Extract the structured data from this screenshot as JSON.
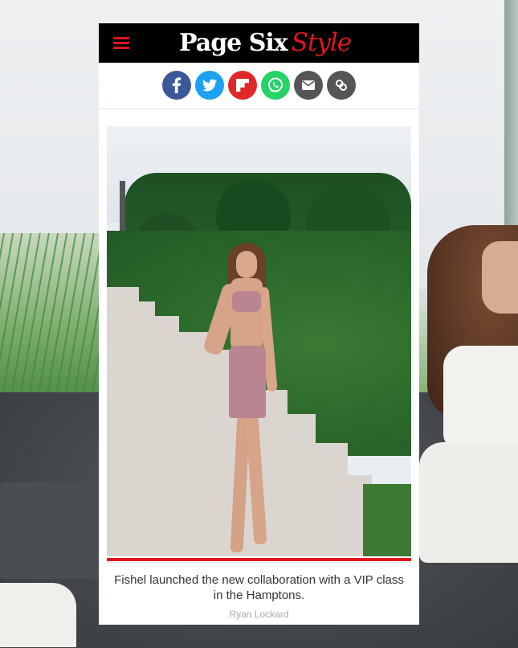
{
  "brand": {
    "logo_main": "Page Six",
    "logo_accent": "Style",
    "accent_color": "#e0161f"
  },
  "share": {
    "buttons": [
      {
        "name": "facebook",
        "icon": "facebook-icon",
        "color": "#3b5998"
      },
      {
        "name": "twitter",
        "icon": "twitter-icon",
        "color": "#1da1f2"
      },
      {
        "name": "flipboard",
        "icon": "flipboard-icon",
        "color": "#e12828"
      },
      {
        "name": "whatsapp",
        "icon": "whatsapp-icon",
        "color": "#25d366"
      },
      {
        "name": "email",
        "icon": "envelope-icon",
        "color": "#555555"
      },
      {
        "name": "copy-link",
        "icon": "link-icon",
        "color": "#555555"
      }
    ]
  },
  "article": {
    "caption": "Fishel launched the new collaboration with a VIP class in the Hamptons.",
    "credit": "Ryan Lockard"
  }
}
